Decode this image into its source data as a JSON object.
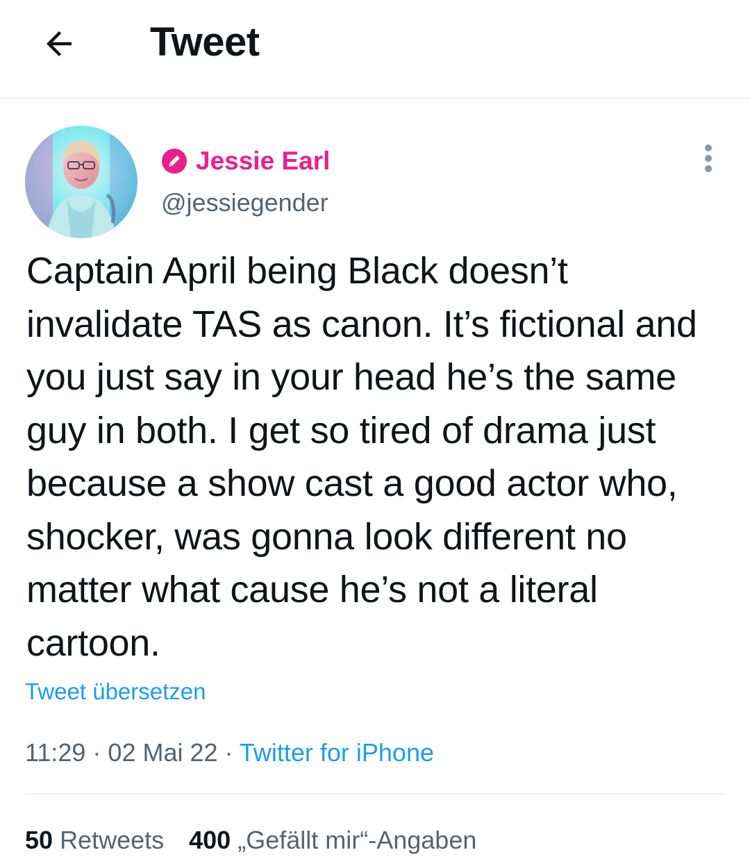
{
  "header": {
    "title": "Tweet",
    "back_icon": "arrow-left-icon"
  },
  "author": {
    "name": "Jessie Earl",
    "handle": "@jessiegender",
    "badge_icon": "pencil-badge-icon",
    "name_color": "#ea1f8a"
  },
  "tweet": {
    "text": "Captain April being Black doesn’t invalidate TAS as canon. It’s fictional and you just say in your head he’s the same guy in both. I get so tired of drama just because a show cast a good actor who, shocker, was gonna look different no matter what cause he’s not a literal cartoon.",
    "translate_label": "Tweet übersetzen",
    "time": "11:29",
    "date": "02 Mai 22",
    "source": "Twitter for iPhone",
    "separator": " · "
  },
  "stats": {
    "retweets_count": "50",
    "retweets_label": "Retweets",
    "likes_count": "400",
    "likes_label": "„Gefällt mir“-Angaben"
  },
  "colors": {
    "link": "#1d9bf0",
    "secondary": "#536471",
    "text": "#0f1419",
    "divider": "#eff3f4"
  }
}
